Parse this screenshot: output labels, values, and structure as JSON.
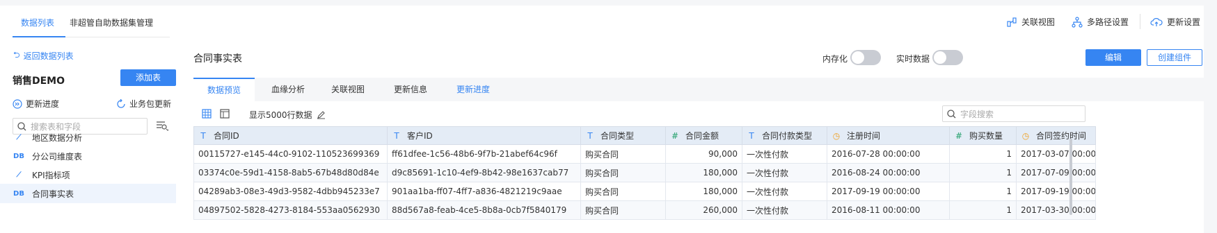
{
  "top_tabs": [
    {
      "label": "数据列表",
      "active": true
    },
    {
      "label": "非超管自助数据集管理",
      "active": false
    }
  ],
  "top_actions": {
    "relation_view": "关联视图",
    "multipath": "多路径设置",
    "update_settings": "更新设置"
  },
  "sidebar": {
    "back_label": "返回数据列表",
    "package_title": "销售DEMO",
    "add_table_label": "添加表",
    "update_progress_label": "更新进度",
    "package_update_label": "业务包更新",
    "search_placeholder": "搜索表和字段",
    "items": [
      {
        "icon": "chart-line-icon",
        "icon_text": "⟋",
        "label": "地区数据分析"
      },
      {
        "icon": "db-icon",
        "icon_text": "DB",
        "label": "分公司维度表"
      },
      {
        "icon": "chart-line-icon",
        "icon_text": "⟋",
        "label": "KPI指标项"
      },
      {
        "icon": "db-icon",
        "icon_text": "DB",
        "label": "合同事实表",
        "active": true
      }
    ]
  },
  "main": {
    "title": "合同事实表",
    "in_memory_label": "内存化",
    "realtime_label": "实时数据",
    "edit_label": "编辑",
    "create_component_label": "创建组件",
    "subtabs": [
      "数据预览",
      "血缘分析",
      "关联视图",
      "更新信息",
      "更新进度"
    ],
    "row_limit_label": "显示5000行数据",
    "field_search_placeholder": "字段搜索"
  },
  "table": {
    "columns": [
      {
        "type": "T",
        "label": "合同ID"
      },
      {
        "type": "T",
        "label": "客户ID"
      },
      {
        "type": "T",
        "label": "合同类型"
      },
      {
        "type": "#",
        "label": "合同金额"
      },
      {
        "type": "T",
        "label": "合同付款类型"
      },
      {
        "type": "time",
        "label": "注册时间"
      },
      {
        "type": "#",
        "label": "购买数量"
      },
      {
        "type": "time",
        "label": "合同签约时间"
      }
    ],
    "rows": [
      [
        "00115727-e145-44c0-9102-110523699369",
        "ff61dfee-1c56-48b6-9f7b-21abef64c96f",
        "购买合同",
        "90,000",
        "一次性付款",
        "2016-07-28 00:00:00",
        "1",
        "2017-03-07 00:00"
      ],
      [
        "03374c0e-59d1-4158-8ab5-67b48d80d84e",
        "d9c85691-1c10-4ef9-8b42-98e1637cab77",
        "购买合同",
        "180,000",
        "一次性付款",
        "2016-08-24 00:00:00",
        "1",
        "2017-07-09 00:00"
      ],
      [
        "04289ab3-08e3-49d3-9582-4dbb945233e7",
        "901aa1ba-ff07-4ff7-a836-4821219c9aae",
        "购买合同",
        "180,000",
        "一次性付款",
        "2017-09-19 00:00:00",
        "1",
        "2017-09-19 00:00"
      ],
      [
        "04897502-5828-4273-8184-553aa0562930",
        "88d567a8-feab-4ce5-8b8a-0cb7f5840179",
        "购买合同",
        "260,000",
        "一次性付款",
        "2016-08-11 00:00:00",
        "1",
        "2017-03-30 00:00"
      ]
    ]
  },
  "colors": {
    "accent": "#3685f2",
    "numeric_icon": "#22a06b",
    "time_icon": "#f0a020"
  }
}
